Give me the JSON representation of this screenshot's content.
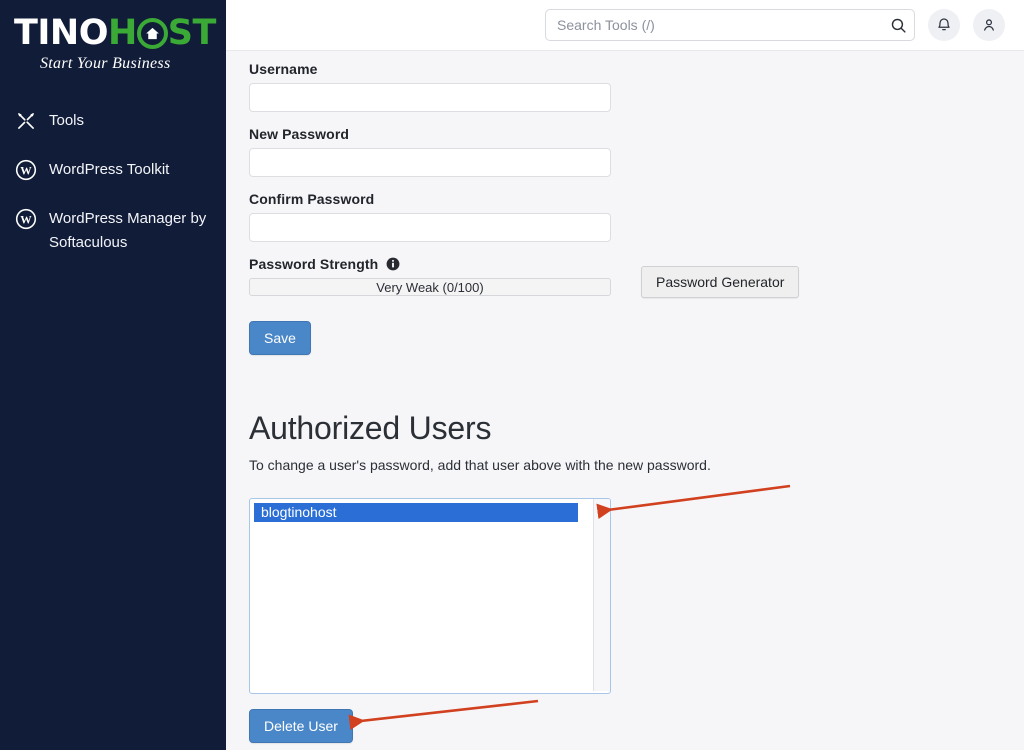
{
  "sidebar": {
    "logo": {
      "text_part1": "TINO",
      "text_part2": "H",
      "text_part3": "ST",
      "icon": "house-in-circle-icon",
      "tagline": "Start Your Business"
    },
    "items": [
      {
        "label": "Tools",
        "icon": "tools-icon"
      },
      {
        "label": "WordPress Toolkit",
        "icon": "wordpress-icon"
      },
      {
        "label": "WordPress Manager by Softaculous",
        "icon": "wordpress-icon"
      }
    ]
  },
  "header": {
    "search": {
      "placeholder": "Search Tools (/)",
      "value": "",
      "icon": "search-icon"
    },
    "notifications_icon": "bell-icon",
    "account_icon": "user-icon"
  },
  "form": {
    "username": {
      "label": "Username",
      "value": "",
      "placeholder": ""
    },
    "new_password": {
      "label": "New Password",
      "value": "",
      "placeholder": ""
    },
    "confirm_password": {
      "label": "Confirm Password",
      "value": "",
      "placeholder": ""
    },
    "password_strength": {
      "label": "Password Strength",
      "info_icon": "info-icon",
      "value_text": "Very Weak (0/100)",
      "score": 0,
      "max_score": 100
    },
    "password_generator_label": "Password Generator",
    "save_label": "Save"
  },
  "authorized_users": {
    "title": "Authorized Users",
    "description": "To change a user's password, add that user above with the new password.",
    "users": [
      {
        "name": "blogtinohost",
        "selected": true
      }
    ],
    "delete_label": "Delete User"
  },
  "colors": {
    "sidebar_bg": "#111c38",
    "logo_green": "#3ba935",
    "primary_button": "#4a87c9",
    "selection_blue": "#2a6ed6",
    "annotation_red": "#d1401f",
    "main_bg": "#f6f6f8"
  }
}
